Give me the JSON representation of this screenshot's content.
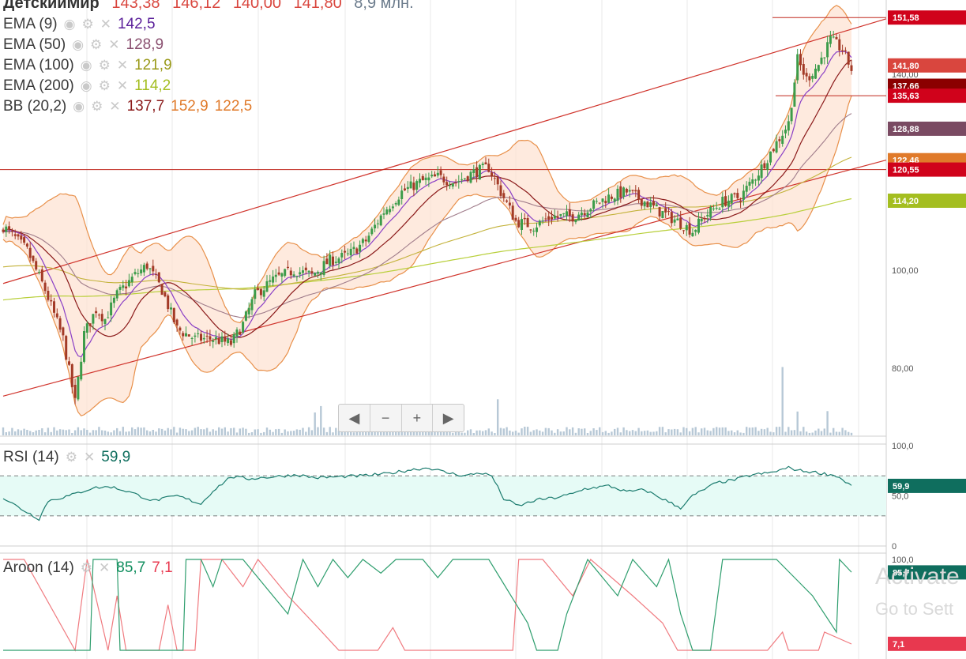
{
  "header": {
    "title": "ДетскийМир",
    "open": "143,38",
    "high": "146,12",
    "low": "140,00",
    "close": "141,80",
    "volume": "8,9 млн."
  },
  "indicators": [
    {
      "name": "EMA (9)",
      "values": [
        "142,5"
      ],
      "colors": [
        "#5a1f9a"
      ]
    },
    {
      "name": "EMA (50)",
      "values": [
        "128,9"
      ],
      "colors": [
        "#8a5070"
      ]
    },
    {
      "name": "EMA (100)",
      "values": [
        "121,9"
      ],
      "colors": [
        "#9a9a1a"
      ]
    },
    {
      "name": "EMA (200)",
      "values": [
        "114,2"
      ],
      "colors": [
        "#a4be20"
      ]
    },
    {
      "name": "BB (20,2)",
      "values": [
        "137,7",
        "152,9",
        "122,5"
      ],
      "colors": [
        "#8b1a1a",
        "#e07a2a",
        "#e07a2a"
      ]
    }
  ],
  "rsi_legend": {
    "name": "RSI (14)",
    "value": "59,9"
  },
  "aroon_legend": {
    "name": "Aroon (14)",
    "up": "85,7",
    "down": "7,1"
  },
  "price_axis": [
    "80,00",
    "100,00",
    "140,00"
  ],
  "rsi_axis": [
    "100,0",
    "50,0",
    "0"
  ],
  "aroon_axis": [
    "100,0"
  ],
  "price_tags": [
    {
      "label": "151,58",
      "value": 151.58,
      "color": "#d0021b"
    },
    {
      "label": "141,80",
      "value": 141.8,
      "color": "#d9463e"
    },
    {
      "label": "137,66",
      "value": 137.66,
      "color": "#8b0000"
    },
    {
      "label": "135,63",
      "value": 135.63,
      "color": "#d0021b"
    },
    {
      "label": "128,88",
      "value": 128.88,
      "color": "#7a4a62"
    },
    {
      "label": "122,46",
      "value": 122.46,
      "color": "#e07a2a"
    },
    {
      "label": "120,55",
      "value": 120.55,
      "color": "#d0021b"
    },
    {
      "label": "114,20",
      "value": 114.2,
      "color": "#a4be20"
    }
  ],
  "rsi_tag": {
    "label": "59,9",
    "value": 59.9,
    "color": "#0f6e5e"
  },
  "aroon_tags": [
    {
      "label": "85,7",
      "value": 85.7,
      "color": "#0f6e5e"
    },
    {
      "label": "7,1",
      "value": 7.1,
      "color": "#e8384f"
    }
  ],
  "navigation": {
    "prev": "◀",
    "zoom_out": "−",
    "zoom_in": "+",
    "next": "▶"
  },
  "watermark": {
    "line1": "Activate",
    "line2": "Go to Sett"
  },
  "chart_data": {
    "type": "candlestick",
    "main": {
      "ylim": [
        68,
        155
      ],
      "anchors": [
        [
          0,
          109
        ],
        [
          8,
          104
        ],
        [
          14,
          96
        ],
        [
          20,
          86
        ],
        [
          24,
          73
        ],
        [
          27,
          87
        ],
        [
          31,
          92
        ],
        [
          34,
          90
        ],
        [
          38,
          95
        ],
        [
          44,
          99
        ],
        [
          48,
          101
        ],
        [
          53,
          96
        ],
        [
          58,
          88
        ],
        [
          64,
          86
        ],
        [
          70,
          86
        ],
        [
          76,
          85
        ],
        [
          80,
          89
        ],
        [
          84,
          95
        ],
        [
          90,
          98
        ],
        [
          97,
          100
        ],
        [
          103,
          99
        ],
        [
          109,
          102
        ],
        [
          115,
          103
        ],
        [
          121,
          106
        ],
        [
          127,
          112
        ],
        [
          133,
          116
        ],
        [
          139,
          118
        ],
        [
          145,
          119
        ],
        [
          151,
          118
        ],
        [
          157,
          120
        ],
        [
          162,
          121
        ],
        [
          166,
          116
        ],
        [
          171,
          110
        ],
        [
          177,
          109
        ],
        [
          183,
          111
        ],
        [
          190,
          111
        ],
        [
          196,
          113
        ],
        [
          202,
          115
        ],
        [
          208,
          116
        ],
        [
          214,
          114
        ],
        [
          219,
          112
        ],
        [
          225,
          110
        ],
        [
          230,
          108
        ],
        [
          234,
          111
        ],
        [
          240,
          114
        ],
        [
          246,
          115
        ],
        [
          252,
          120
        ],
        [
          258,
          126
        ],
        [
          262,
          130
        ],
        [
          265,
          143
        ],
        [
          268,
          139
        ],
        [
          272,
          142
        ],
        [
          276,
          147
        ],
        [
          280,
          145
        ],
        [
          283,
          141
        ]
      ],
      "seed": 7,
      "levels": [
        151.58,
        135.63,
        120.55
      ],
      "channel": [
        [
          0,
          97.3,
          283,
          149.2
        ],
        [
          0,
          74.3,
          283,
          120.6
        ]
      ],
      "volume_spikes": [
        [
          104,
          25
        ],
        [
          106,
          32
        ],
        [
          165,
          38
        ],
        [
          260,
          80
        ],
        [
          265,
          25
        ],
        [
          275,
          25
        ]
      ]
    },
    "rsi": {
      "ylim": [
        0,
        100
      ],
      "bands": [
        30,
        70
      ],
      "anchors": [
        [
          0,
          48
        ],
        [
          6,
          37
        ],
        [
          12,
          27
        ],
        [
          15,
          45
        ],
        [
          22,
          50
        ],
        [
          30,
          58
        ],
        [
          36,
          59
        ],
        [
          42,
          54
        ],
        [
          50,
          45
        ],
        [
          58,
          50
        ],
        [
          66,
          42
        ],
        [
          70,
          55
        ],
        [
          76,
          69
        ],
        [
          82,
          67
        ],
        [
          90,
          69
        ],
        [
          98,
          71
        ],
        [
          104,
          68
        ],
        [
          112,
          69
        ],
        [
          120,
          70
        ],
        [
          128,
          72
        ],
        [
          136,
          76
        ],
        [
          142,
          78
        ],
        [
          148,
          73
        ],
        [
          154,
          70
        ],
        [
          159,
          73
        ],
        [
          163,
          70
        ],
        [
          167,
          47
        ],
        [
          172,
          40
        ],
        [
          178,
          46
        ],
        [
          184,
          48
        ],
        [
          190,
          52
        ],
        [
          194,
          57
        ],
        [
          202,
          60
        ],
        [
          208,
          54
        ],
        [
          214,
          56
        ],
        [
          220,
          47
        ],
        [
          226,
          38
        ],
        [
          230,
          50
        ],
        [
          238,
          63
        ],
        [
          244,
          66
        ],
        [
          250,
          71
        ],
        [
          256,
          73
        ],
        [
          262,
          78
        ],
        [
          266,
          75
        ],
        [
          272,
          73
        ],
        [
          278,
          70
        ],
        [
          283,
          60
        ]
      ]
    },
    "aroon": {
      "ylim": [
        0,
        100
      ],
      "up": [
        [
          0,
          0
        ],
        [
          29,
          0
        ],
        [
          30,
          100
        ],
        [
          38,
          100
        ],
        [
          39,
          0
        ],
        [
          60,
          0
        ],
        [
          61,
          100
        ],
        [
          66,
          100
        ],
        [
          70,
          70
        ],
        [
          73,
          100
        ],
        [
          80,
          100
        ],
        [
          95,
          40
        ],
        [
          100,
          100
        ],
        [
          105,
          70
        ],
        [
          110,
          100
        ],
        [
          115,
          80
        ],
        [
          120,
          100
        ],
        [
          126,
          85
        ],
        [
          131,
          100
        ],
        [
          140,
          100
        ],
        [
          145,
          80
        ],
        [
          150,
          100
        ],
        [
          162,
          100
        ],
        [
          175,
          30
        ],
        [
          178,
          0
        ],
        [
          185,
          0
        ],
        [
          188,
          40
        ],
        [
          195,
          100
        ],
        [
          205,
          60
        ],
        [
          210,
          100
        ],
        [
          218,
          70
        ],
        [
          222,
          100
        ],
        [
          226,
          40
        ],
        [
          230,
          0
        ],
        [
          236,
          0
        ],
        [
          240,
          100
        ],
        [
          258,
          100
        ],
        [
          270,
          60
        ],
        [
          278,
          20
        ],
        [
          279,
          100
        ],
        [
          283,
          86
        ]
      ],
      "down": [
        [
          0,
          100
        ],
        [
          7,
          100
        ],
        [
          24,
          0
        ],
        [
          28,
          100
        ],
        [
          35,
          0
        ],
        [
          38,
          60
        ],
        [
          41,
          0
        ],
        [
          52,
          0
        ],
        [
          55,
          50
        ],
        [
          58,
          0
        ],
        [
          64,
          0
        ],
        [
          66,
          100
        ],
        [
          73,
          100
        ],
        [
          80,
          70
        ],
        [
          85,
          100
        ],
        [
          95,
          60
        ],
        [
          105,
          25
        ],
        [
          112,
          0
        ],
        [
          125,
          0
        ],
        [
          130,
          25
        ],
        [
          134,
          0
        ],
        [
          170,
          0
        ],
        [
          172,
          100
        ],
        [
          180,
          100
        ],
        [
          190,
          60
        ],
        [
          196,
          100
        ],
        [
          210,
          60
        ],
        [
          220,
          30
        ],
        [
          225,
          0
        ],
        [
          255,
          0
        ],
        [
          260,
          20
        ],
        [
          262,
          0
        ],
        [
          272,
          0
        ],
        [
          274,
          20
        ],
        [
          283,
          7
        ]
      ]
    }
  }
}
